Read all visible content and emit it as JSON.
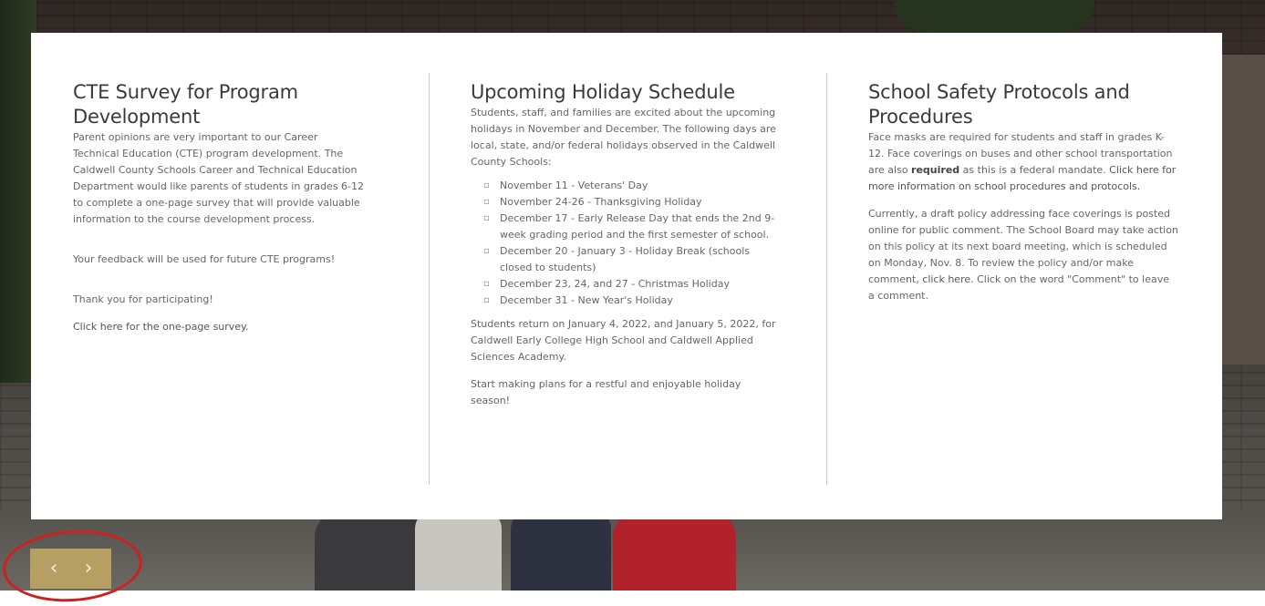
{
  "col1": {
    "title": "CTE Survey for Program Development",
    "p1": "Parent opinions are very important to our Career Technical Education (CTE) program development. The Caldwell County Schools Career and Technical Education Department would like parents of students in grades 6-12 to complete a one-page survey that will provide valuable information to the course development process.",
    "p2": "Your feedback will be used for future CTE programs!",
    "p3": "Thank you for participating!",
    "link": "Click here for the one-page survey."
  },
  "col2": {
    "title": "Upcoming Holiday Schedule",
    "intro": "Students, staff, and families are excited about the upcoming holidays in November and December. The following days are local, state, and/or federal holidays observed in the Caldwell County Schools:",
    "items": [
      "November 11 - Veterans' Day",
      "November 24-26 - Thanksgiving Holiday",
      "December 17 - Early Release Day that ends the 2nd 9-week grading period and the first semester of school.",
      "December 20 - January 3 - Holiday Break (schools closed to students)",
      "December 23, 24, and 27 - Christmas Holiday",
      "December 31 - New Year's Holiday"
    ],
    "p2": "Students return on January 4, 2022, and January 5, 2022, for Caldwell Early College High School and Caldwell Applied Sciences Academy.",
    "p3": "Start making plans for a restful and enjoyable holiday season!"
  },
  "col3": {
    "title": "School Safety Protocols and Procedures",
    "p1a": "Face masks are required for students and staff in grades K-12. Face coverings on buses and other school transportation are also ",
    "p1b": "required",
    "p1c": " as this is a federal mandate. ",
    "p1link": "Click here for more information on school procedures and protocols.",
    "p2a": "Currently, a draft policy addressing face coverings is posted online for public comment. The School Board may take action on this policy at its next board meeting, which is scheduled on Monday, Nov. 8. To review the policy and/or make comment, ",
    "p2link": "click here.",
    "p2b": "  Click on the word \"Comment\" to leave a comment."
  },
  "nav": {
    "prev": "‹",
    "next": "›"
  }
}
